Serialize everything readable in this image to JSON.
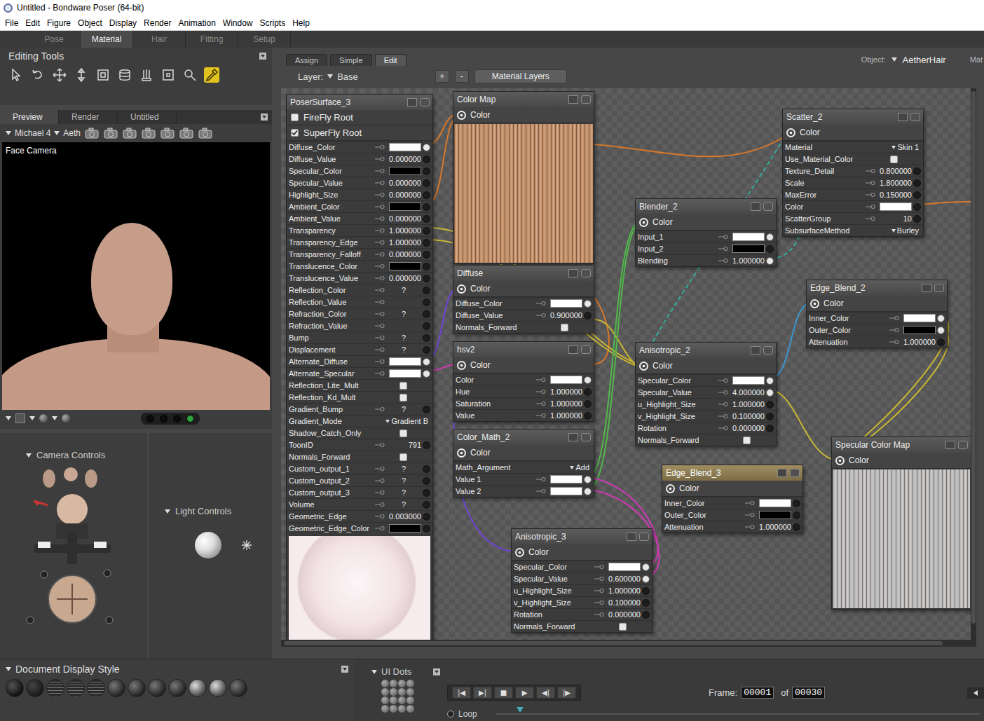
{
  "window": {
    "title": "Untitled - Bondware Poser (64-bit)"
  },
  "menu": [
    "File",
    "Edit",
    "Figure",
    "Object",
    "Display",
    "Render",
    "Animation",
    "Window",
    "Scripts",
    "Help"
  ],
  "rooms": [
    {
      "label": "Pose",
      "selected": false
    },
    {
      "label": "Material",
      "selected": true
    },
    {
      "label": "Hair",
      "selected": false
    },
    {
      "label": "Fitting",
      "selected": false
    },
    {
      "label": "Setup",
      "selected": false
    }
  ],
  "editing_tools": {
    "title": "Editing Tools",
    "tools": [
      {
        "selected": false
      },
      {
        "selected": false
      },
      {
        "selected": false
      },
      {
        "selected": false
      },
      {
        "selected": false
      },
      {
        "selected": false
      },
      {
        "selected": false
      },
      {
        "selected": false
      },
      {
        "selected": false
      },
      {
        "selected": true
      }
    ]
  },
  "preview": {
    "tabs": [
      {
        "label": "Preview",
        "selected": true
      },
      {
        "label": "Render",
        "selected": false
      },
      {
        "label": "Untitled",
        "selected": false
      }
    ],
    "figure": "Michael 4",
    "element": "Aeth",
    "camera": "Face Camera",
    "dots": [
      {
        "selected": false
      },
      {
        "selected": false
      },
      {
        "selected": false
      },
      {
        "selected": true
      }
    ]
  },
  "camera_controls": {
    "title": "Camera Controls"
  },
  "light_controls": {
    "title": "Light Controls"
  },
  "material": {
    "tabs": [
      {
        "label": "Assign",
        "selected": false
      },
      {
        "label": "Simple",
        "selected": false
      },
      {
        "label": "Edit",
        "selected": true
      }
    ],
    "object_label": "Object:",
    "object": "AetherHair",
    "clipped": "Mat",
    "layer_label": "Layer:",
    "layer": "Base",
    "layer_buttons": [
      "+",
      "-"
    ],
    "layers_button": "Material Layers",
    "nodes": [
      {
        "title": "PoserSurface_3",
        "kind": "root",
        "selected": false,
        "roots": [
          {
            "label": "FireFly Root",
            "checked": false
          },
          {
            "label": "SuperFly Root",
            "checked": true
          }
        ],
        "rows": [
          {
            "label": "Diffuse_Color",
            "kind": "color",
            "color": "#ffffff",
            "linked": true
          },
          {
            "label": "Diffuse_Value",
            "kind": "number",
            "value": "0.000000",
            "linked": false
          },
          {
            "label": "Specular_Color",
            "kind": "color",
            "color": "#000000",
            "linked": false
          },
          {
            "label": "Specular_Value",
            "kind": "number",
            "value": "0.000000",
            "linked": false
          },
          {
            "label": "Highlight_Size",
            "kind": "number",
            "value": "0.000000",
            "linked": false
          },
          {
            "label": "Ambient_Color",
            "kind": "color",
            "color": "#000000",
            "linked": false
          },
          {
            "label": "Ambient_Value",
            "kind": "number",
            "value": "0.000000",
            "linked": false
          },
          {
            "label": "Transparency",
            "kind": "number",
            "value": "1.000000",
            "linked": false
          },
          {
            "label": "Transparency_Edge",
            "kind": "number",
            "value": "1.000000",
            "linked": false
          },
          {
            "label": "Transparency_Falloff",
            "kind": "number",
            "value": "0.000000",
            "linked": false
          },
          {
            "label": "Translucence_Color",
            "kind": "color",
            "color": "#000000",
            "linked": false
          },
          {
            "label": "Translucence_Value",
            "kind": "number",
            "value": "0.000000",
            "linked": false
          },
          {
            "label": "Reflection_Color",
            "kind": "link",
            "value": "?",
            "linked": false
          },
          {
            "label": "Reflection_Value",
            "kind": "none",
            "linked": false
          },
          {
            "label": "Refraction_Color",
            "kind": "link",
            "value": "?",
            "linked": false
          },
          {
            "label": "Refraction_Value",
            "kind": "none",
            "linked": false
          },
          {
            "label": "Bump",
            "kind": "link",
            "value": "?",
            "linked": false
          },
          {
            "label": "Displacement",
            "kind": "link",
            "value": "?",
            "linked": false
          },
          {
            "label": "Alternate_Diffuse",
            "kind": "color",
            "color": "#ffffff",
            "linked": true
          },
          {
            "label": "Alternate_Specular",
            "kind": "color",
            "color": "#ffffff",
            "linked": true
          },
          {
            "label": "Reflection_Lite_Mult",
            "kind": "check",
            "checked": false
          },
          {
            "label": "Reflection_Kd_Mult",
            "kind": "check",
            "checked": false
          },
          {
            "label": "Gradient_Bump",
            "kind": "link",
            "value": "?",
            "linked": false
          },
          {
            "label": "Gradient_Mode",
            "kind": "menu",
            "value": "Gradient B"
          },
          {
            "label": "Shadow_Catch_Only",
            "kind": "check",
            "checked": false
          },
          {
            "label": "ToonID",
            "kind": "number",
            "value": "791",
            "linked": false
          },
          {
            "label": "Normals_Forward",
            "kind": "check",
            "checked": false
          },
          {
            "label": "Custom_output_1",
            "kind": "link",
            "value": "?",
            "linked": false
          },
          {
            "label": "Custom_output_2",
            "kind": "link",
            "value": "?",
            "linked": false
          },
          {
            "label": "Custom_output_3",
            "kind": "link",
            "value": "?",
            "linked": false
          },
          {
            "label": "Volume",
            "kind": "link",
            "value": "?",
            "linked": false
          },
          {
            "label": "Geometric_Edge",
            "kind": "number",
            "value": "0.003000",
            "linked": false
          },
          {
            "label": "Geometric_Edge_Color",
            "kind": "color",
            "color": "#000000",
            "linked": false
          }
        ]
      },
      {
        "title": "Color Map",
        "kind": "image",
        "selected": false,
        "output": "Color",
        "color": "#c4916a",
        "rows": []
      },
      {
        "title": "Diffuse",
        "kind": "node",
        "selected": false,
        "output": "Color",
        "rows": [
          {
            "label": "Diffuse_Color",
            "kind": "color",
            "color": "#ffffff",
            "linked": true
          },
          {
            "label": "Diffuse_Value",
            "kind": "number",
            "value": "0.900000",
            "linked": false
          },
          {
            "label": "Normals_Forward",
            "kind": "check",
            "checked": false
          }
        ]
      },
      {
        "title": "hsv2",
        "kind": "node",
        "selected": false,
        "output": "Color",
        "rows": [
          {
            "label": "Color",
            "kind": "color",
            "color": "#ffffff",
            "linked": true
          },
          {
            "label": "Hue",
            "kind": "number",
            "value": "1.000000",
            "linked": false
          },
          {
            "label": "Saturation",
            "kind": "number",
            "value": "1.000000",
            "linked": false
          },
          {
            "label": "Value",
            "kind": "number",
            "value": "1.000000",
            "linked": false
          }
        ]
      },
      {
        "title": "Color_Math_2",
        "kind": "node",
        "selected": false,
        "output": "Color",
        "rows": [
          {
            "label": "Math_Argument",
            "kind": "menu",
            "value": "Add"
          },
          {
            "label": "Value 1",
            "kind": "color",
            "color": "#ffffff",
            "linked": true
          },
          {
            "label": "Value 2",
            "kind": "color",
            "color": "#ffffff",
            "linked": true
          }
        ]
      },
      {
        "title": "Anisotropic_3",
        "kind": "node",
        "selected": false,
        "output": "Color",
        "rows": [
          {
            "label": "Specular_Color",
            "kind": "color",
            "color": "#ffffff",
            "linked": true
          },
          {
            "label": "Specular_Value",
            "kind": "number",
            "value": "0.600000",
            "linked": true
          },
          {
            "label": "u_Highlight_Size",
            "kind": "number",
            "value": "1.000000",
            "linked": false
          },
          {
            "label": "v_Highlight_Size",
            "kind": "number",
            "value": "0.100000",
            "linked": false
          },
          {
            "label": "Rotation",
            "kind": "number",
            "value": "0.000000",
            "linked": false
          },
          {
            "label": "Normals_Forward",
            "kind": "check",
            "checked": false
          }
        ]
      },
      {
        "title": "Blender_2",
        "kind": "node",
        "selected": false,
        "output": "Color",
        "rows": [
          {
            "label": "Input_1",
            "kind": "color",
            "color": "#ffffff",
            "linked": true
          },
          {
            "label": "Input_2",
            "kind": "color",
            "color": "#000000",
            "linked": false
          },
          {
            "label": "Blending",
            "kind": "number",
            "value": "1.000000",
            "linked": true
          }
        ]
      },
      {
        "title": "Anisotropic_2",
        "kind": "node",
        "selected": false,
        "output": "Color",
        "rows": [
          {
            "label": "Specular_Color",
            "kind": "color",
            "color": "#ffffff",
            "linked": true
          },
          {
            "label": "Specular_Value",
            "kind": "number",
            "value": "4.000000",
            "linked": true
          },
          {
            "label": "u_Highlight_Size",
            "kind": "number",
            "value": "1.000000",
            "linked": false
          },
          {
            "label": "v_Highlight_Size",
            "kind": "number",
            "value": "0.100000",
            "linked": false
          },
          {
            "label": "Rotation",
            "kind": "number",
            "value": "0.000000",
            "linked": false
          },
          {
            "label": "Normals_Forward",
            "kind": "check",
            "checked": false
          }
        ]
      },
      {
        "title": "Edge_Blend_3",
        "kind": "node",
        "selected": true,
        "output": "Color",
        "rows": [
          {
            "label": "Inner_Color",
            "kind": "color",
            "color": "#ffffff",
            "linked": false
          },
          {
            "label": "Outer_Color",
            "kind": "color",
            "color": "#000000",
            "linked": false
          },
          {
            "label": "Attenuation",
            "kind": "number",
            "value": "1.000000",
            "linked": false
          }
        ]
      },
      {
        "title": "Scatter_2",
        "kind": "node",
        "selected": false,
        "output": "Color",
        "rows": [
          {
            "label": "Material",
            "kind": "menu",
            "value": "Skin 1"
          },
          {
            "label": "Use_Material_Color",
            "kind": "check",
            "checked": false
          },
          {
            "label": "Texture_Detail",
            "kind": "number",
            "value": "0.800000",
            "linked": false
          },
          {
            "label": "Scale",
            "kind": "number",
            "value": "1.800000",
            "linked": false
          },
          {
            "label": "MaxError",
            "kind": "number",
            "value": "0.150000",
            "linked": false
          },
          {
            "label": "Color",
            "kind": "color",
            "color": "#ffffff",
            "linked": false
          },
          {
            "label": "ScatterGroup",
            "kind": "number",
            "value": "10",
            "linked": false
          },
          {
            "label": "SubsurfaceMethod",
            "kind": "menu",
            "value": "Burley"
          }
        ]
      },
      {
        "title": "Edge_Blend_2",
        "kind": "node",
        "selected": false,
        "output": "Color",
        "rows": [
          {
            "label": "Inner_Color",
            "kind": "color",
            "color": "#ffffff",
            "linked": true
          },
          {
            "label": "Outer_Color",
            "kind": "color",
            "color": "#000000",
            "linked": true
          },
          {
            "label": "Attenuation",
            "kind": "number",
            "value": "1.000000",
            "linked": false
          }
        ]
      },
      {
        "title": "Specular Color Map",
        "kind": "image",
        "selected": false,
        "output": "Color",
        "color": "#bdbdbd",
        "rows": []
      }
    ],
    "wires": [
      {
        "color": "#d8782a",
        "dashed": false
      },
      {
        "color": "#d8782a",
        "dashed": false
      },
      {
        "color": "#d8782a",
        "dashed": false
      },
      {
        "color": "#d8782a",
        "dashed": false
      },
      {
        "color": "#d8782a",
        "dashed": false
      },
      {
        "color": "#c9b634",
        "dashed": false
      },
      {
        "color": "#c9b634",
        "dashed": false
      },
      {
        "color": "#c9b634",
        "dashed": false
      },
      {
        "color": "#52b84a",
        "dashed": false
      },
      {
        "color": "#52b84a",
        "dashed": false
      },
      {
        "color": "#35ad9b",
        "dashed": true
      },
      {
        "color": "#35ad9b",
        "dashed": true
      },
      {
        "color": "#3b97cf",
        "dashed": false
      },
      {
        "color": "#c9b634",
        "dashed": false
      },
      {
        "color": "#c9b634",
        "dashed": false
      },
      {
        "color": "#c9b634",
        "dashed": false
      },
      {
        "color": "#6f44d6",
        "dashed": false
      },
      {
        "color": "#cf3ab4",
        "dashed": false
      },
      {
        "color": "#cf3ab4",
        "dashed": false
      },
      {
        "color": "#cf3ab4",
        "dashed": false
      },
      {
        "color": "#6f44d6",
        "dashed": false
      }
    ]
  },
  "display_style": {
    "title": "Document Display Style"
  },
  "ui_dots": {
    "title": "UI Dots"
  },
  "timeline": {
    "controls": [
      "|◀",
      "▶|",
      "■",
      "▶",
      "◀|",
      "|▶"
    ],
    "frame_label": "Frame:",
    "frame": "00001",
    "of": "of",
    "total": "00030",
    "loop": "Loop"
  }
}
